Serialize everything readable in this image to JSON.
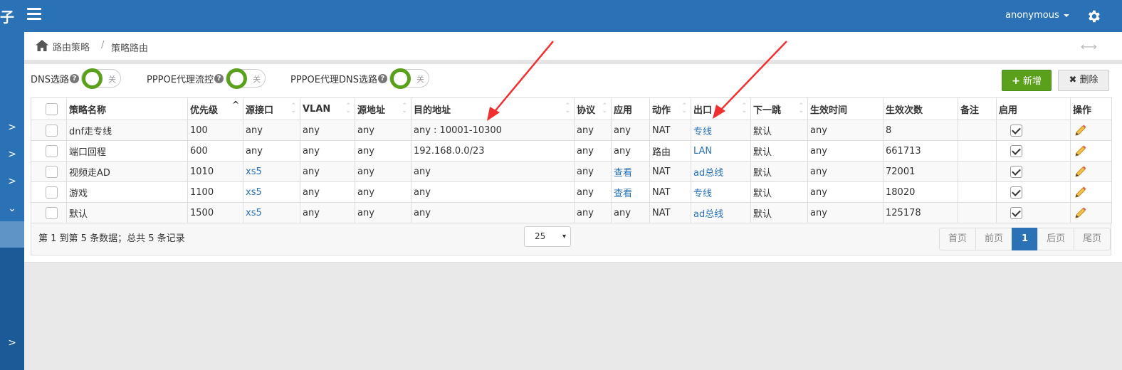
{
  "header": {
    "logo_fragment": "子",
    "user": "anonymous",
    "settings_icon": "gear-icon",
    "menu_icon": "hamburger-icon"
  },
  "sidebar": {
    "items": [
      ">",
      ">",
      ">",
      "⌄",
      ">"
    ]
  },
  "breadcrumb": {
    "home": "路由策略",
    "separator": "/",
    "current": "策略路由",
    "expand_icon": "⟷"
  },
  "toggles": [
    {
      "label": "DNS选路",
      "state": "关"
    },
    {
      "label": "PPPOE代理流控",
      "state": "关"
    },
    {
      "label": "PPPOE代理DNS选路",
      "state": "关"
    }
  ],
  "help_symbol": "?",
  "buttons": {
    "add": "新增",
    "add_icon": "+",
    "delete": "删除",
    "delete_icon": "✖"
  },
  "table": {
    "headers": [
      "策略名称",
      "优先级",
      "源接口",
      "VLAN",
      "源地址",
      "目的地址",
      "协议",
      "应用",
      "动作",
      "出口",
      "下一跳",
      "生效时间",
      "生效次数",
      "备注",
      "启用",
      "操作"
    ],
    "rows": [
      {
        "name": "dnf走专线",
        "priority": "100",
        "src_if": "any",
        "vlan": "any",
        "src_addr": "any",
        "dst_addr": "any : 10001-10300",
        "proto": "any",
        "app": "any",
        "action": "NAT",
        "egress": "专线",
        "next_hop": "默认",
        "time": "any",
        "hits": "8",
        "remark": ""
      },
      {
        "name": "端口回程",
        "priority": "600",
        "src_if": "any",
        "vlan": "any",
        "src_addr": "any",
        "dst_addr": "192.168.0.0/23",
        "proto": "any",
        "app": "any",
        "action": "路由",
        "egress": "LAN",
        "next_hop": "默认",
        "time": "any",
        "hits": "661713",
        "remark": ""
      },
      {
        "name": "视频走AD",
        "priority": "1010",
        "src_if": "xs5",
        "vlan": "any",
        "src_addr": "any",
        "dst_addr": "any",
        "proto": "any",
        "app": "查看",
        "action": "NAT",
        "egress": "ad总线",
        "next_hop": "默认",
        "time": "any",
        "hits": "72001",
        "remark": ""
      },
      {
        "name": "游戏",
        "priority": "1100",
        "src_if": "xs5",
        "vlan": "any",
        "src_addr": "any",
        "dst_addr": "any",
        "proto": "any",
        "app": "查看",
        "action": "NAT",
        "egress": "专线",
        "next_hop": "默认",
        "time": "any",
        "hits": "18020",
        "remark": ""
      },
      {
        "name": "默认",
        "priority": "1500",
        "src_if": "xs5",
        "vlan": "any",
        "src_addr": "any",
        "dst_addr": "any",
        "proto": "any",
        "app": "any",
        "action": "NAT",
        "egress": "ad总线",
        "next_hop": "默认",
        "time": "any",
        "hits": "125178",
        "remark": ""
      }
    ]
  },
  "footer": {
    "info": "第 1 到第 5 条数据；总共 5 条记录",
    "page_size": "25",
    "dropdown": "▾",
    "pager": [
      "首页",
      "前页",
      "1",
      "后页",
      "尾页"
    ]
  },
  "colors": {
    "primary": "#2a72b5",
    "success": "#5aa01b",
    "annotation_arrow": "#f03030"
  }
}
